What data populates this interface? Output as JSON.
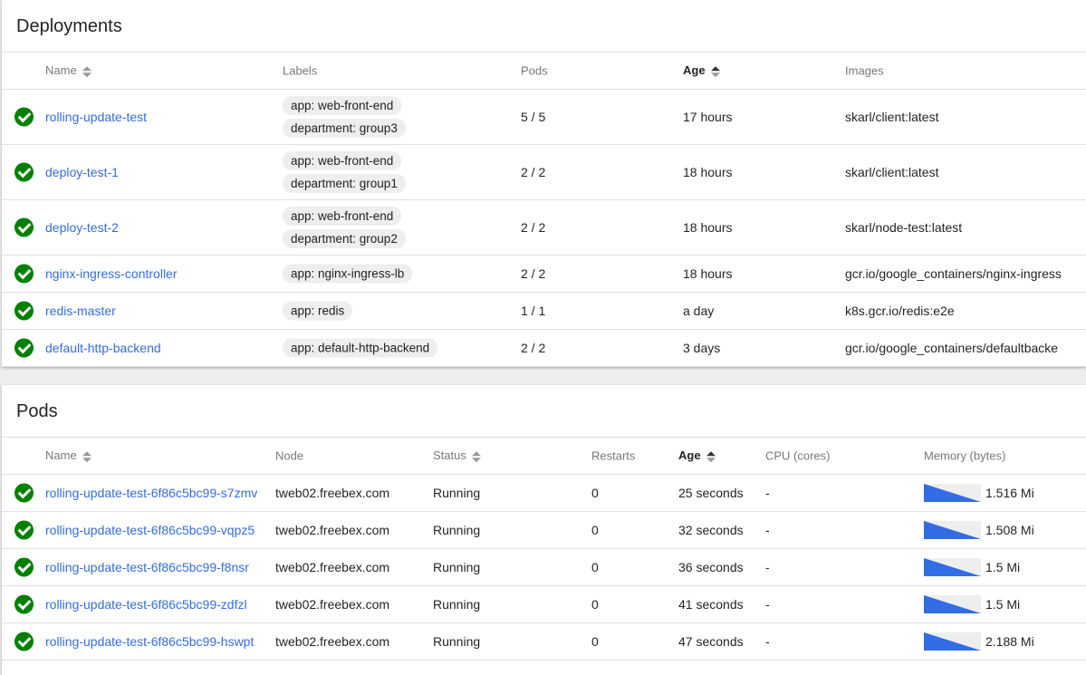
{
  "deployments": {
    "title": "Deployments",
    "headers": {
      "name": "Name",
      "labels": "Labels",
      "pods": "Pods",
      "age": "Age",
      "images": "Images"
    },
    "rows": [
      {
        "name": "rolling-update-test",
        "labels": [
          "app: web-front-end",
          "department: group3"
        ],
        "pods": "5 / 5",
        "age": "17 hours",
        "images": "skarl/client:latest"
      },
      {
        "name": "deploy-test-1",
        "labels": [
          "app: web-front-end",
          "department: group1"
        ],
        "pods": "2 / 2",
        "age": "18 hours",
        "images": "skarl/client:latest"
      },
      {
        "name": "deploy-test-2",
        "labels": [
          "app: web-front-end",
          "department: group2"
        ],
        "pods": "2 / 2",
        "age": "18 hours",
        "images": "skarl/node-test:latest"
      },
      {
        "name": "nginx-ingress-controller",
        "labels": [
          "app: nginx-ingress-lb"
        ],
        "pods": "2 / 2",
        "age": "18 hours",
        "images": "gcr.io/google_containers/nginx-ingress"
      },
      {
        "name": "redis-master",
        "labels": [
          "app: redis"
        ],
        "pods": "1 / 1",
        "age": "a day",
        "images": "k8s.gcr.io/redis:e2e"
      },
      {
        "name": "default-http-backend",
        "labels": [
          "app: default-http-backend"
        ],
        "pods": "2 / 2",
        "age": "3 days",
        "images": "gcr.io/google_containers/defaultbacke"
      }
    ]
  },
  "pods": {
    "title": "Pods",
    "headers": {
      "name": "Name",
      "node": "Node",
      "status": "Status",
      "restarts": "Restarts",
      "age": "Age",
      "cpu": "CPU (cores)",
      "memory": "Memory (bytes)"
    },
    "rows": [
      {
        "name": "rolling-update-test-6f86c5bc99-s7zmv",
        "node": "tweb02.freebex.com",
        "status": "Running",
        "restarts": "0",
        "age": "25 seconds",
        "cpu": "-",
        "memory": "1.516 Mi"
      },
      {
        "name": "rolling-update-test-6f86c5bc99-vqpz5",
        "node": "tweb02.freebex.com",
        "status": "Running",
        "restarts": "0",
        "age": "32 seconds",
        "cpu": "-",
        "memory": "1.508 Mi"
      },
      {
        "name": "rolling-update-test-6f86c5bc99-f8nsr",
        "node": "tweb02.freebex.com",
        "status": "Running",
        "restarts": "0",
        "age": "36 seconds",
        "cpu": "-",
        "memory": "1.5 Mi"
      },
      {
        "name": "rolling-update-test-6f86c5bc99-zdfzl",
        "node": "tweb02.freebex.com",
        "status": "Running",
        "restarts": "0",
        "age": "41 seconds",
        "cpu": "-",
        "memory": "1.5 Mi"
      },
      {
        "name": "rolling-update-test-6f86c5bc99-hswpt",
        "node": "tweb02.freebex.com",
        "status": "Running",
        "restarts": "0",
        "age": "47 seconds",
        "cpu": "-",
        "memory": "2.188 Mi"
      }
    ]
  },
  "colors": {
    "link": "#326de6",
    "ok": "#008000",
    "sparkline": "#326de6"
  }
}
